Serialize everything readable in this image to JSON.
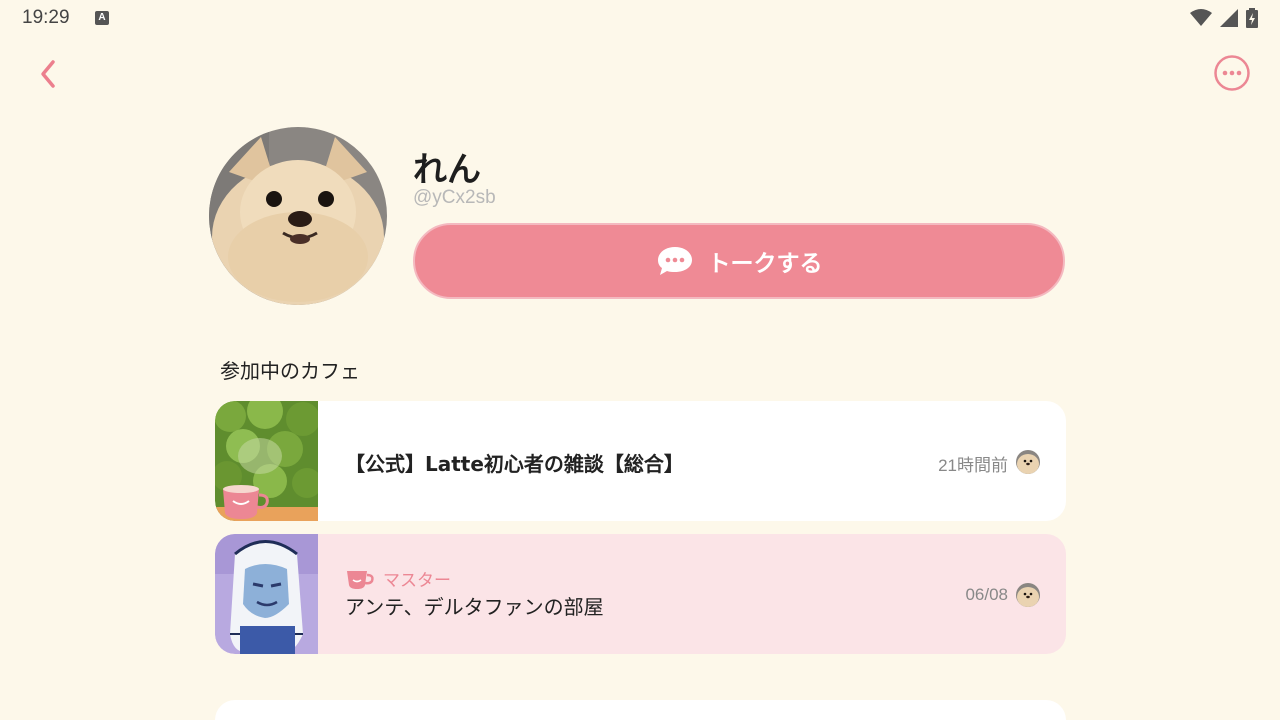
{
  "status_bar": {
    "time": "19:29",
    "notification_glyph": "A"
  },
  "profile": {
    "name": "れん",
    "handle": "@yCx2sb"
  },
  "talk_button": {
    "label": "トークする"
  },
  "section": {
    "title": "参加中のカフェ"
  },
  "cafes": [
    {
      "title": "【公式】Latte初心者の雑談【総合】",
      "time": "21時間前",
      "role": ""
    },
    {
      "title": "アンテ、デルタファンの部屋",
      "time": "06/08",
      "role": "マスター"
    }
  ],
  "colors": {
    "background": "#fdf8ea",
    "accent": "#ef8a95",
    "master_card": "#fbe4e7"
  },
  "icons": [
    "back-chevron-icon",
    "more-options-icon",
    "chat-bubble-icon",
    "cup-icon",
    "wifi-icon",
    "signal-icon",
    "battery-icon"
  ]
}
